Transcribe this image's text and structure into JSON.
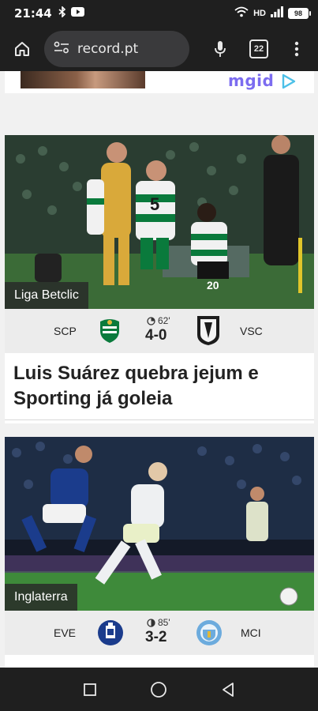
{
  "status_bar": {
    "time": "21:44",
    "network": "HD",
    "battery": "98"
  },
  "browser": {
    "url": "record.pt",
    "tab_count": "22"
  },
  "ad": {
    "logo_text": "mgid"
  },
  "articles": [
    {
      "category": "Liga Betclic",
      "home_code": "SCP",
      "away_code": "VSC",
      "minute": "62'",
      "score": "4-0",
      "headline": "Luis Suárez quebra jejum e Sporting já goleia"
    },
    {
      "category": "Inglaterra",
      "home_code": "EVE",
      "away_code": "MCI",
      "minute": "85'",
      "score": "3-2"
    }
  ],
  "colors": {
    "sporting_green": "#0a7a3c",
    "everton_blue": "#1b3c8c",
    "city_blue": "#6cabdd",
    "mgid_purple": "#7c6cf0"
  }
}
